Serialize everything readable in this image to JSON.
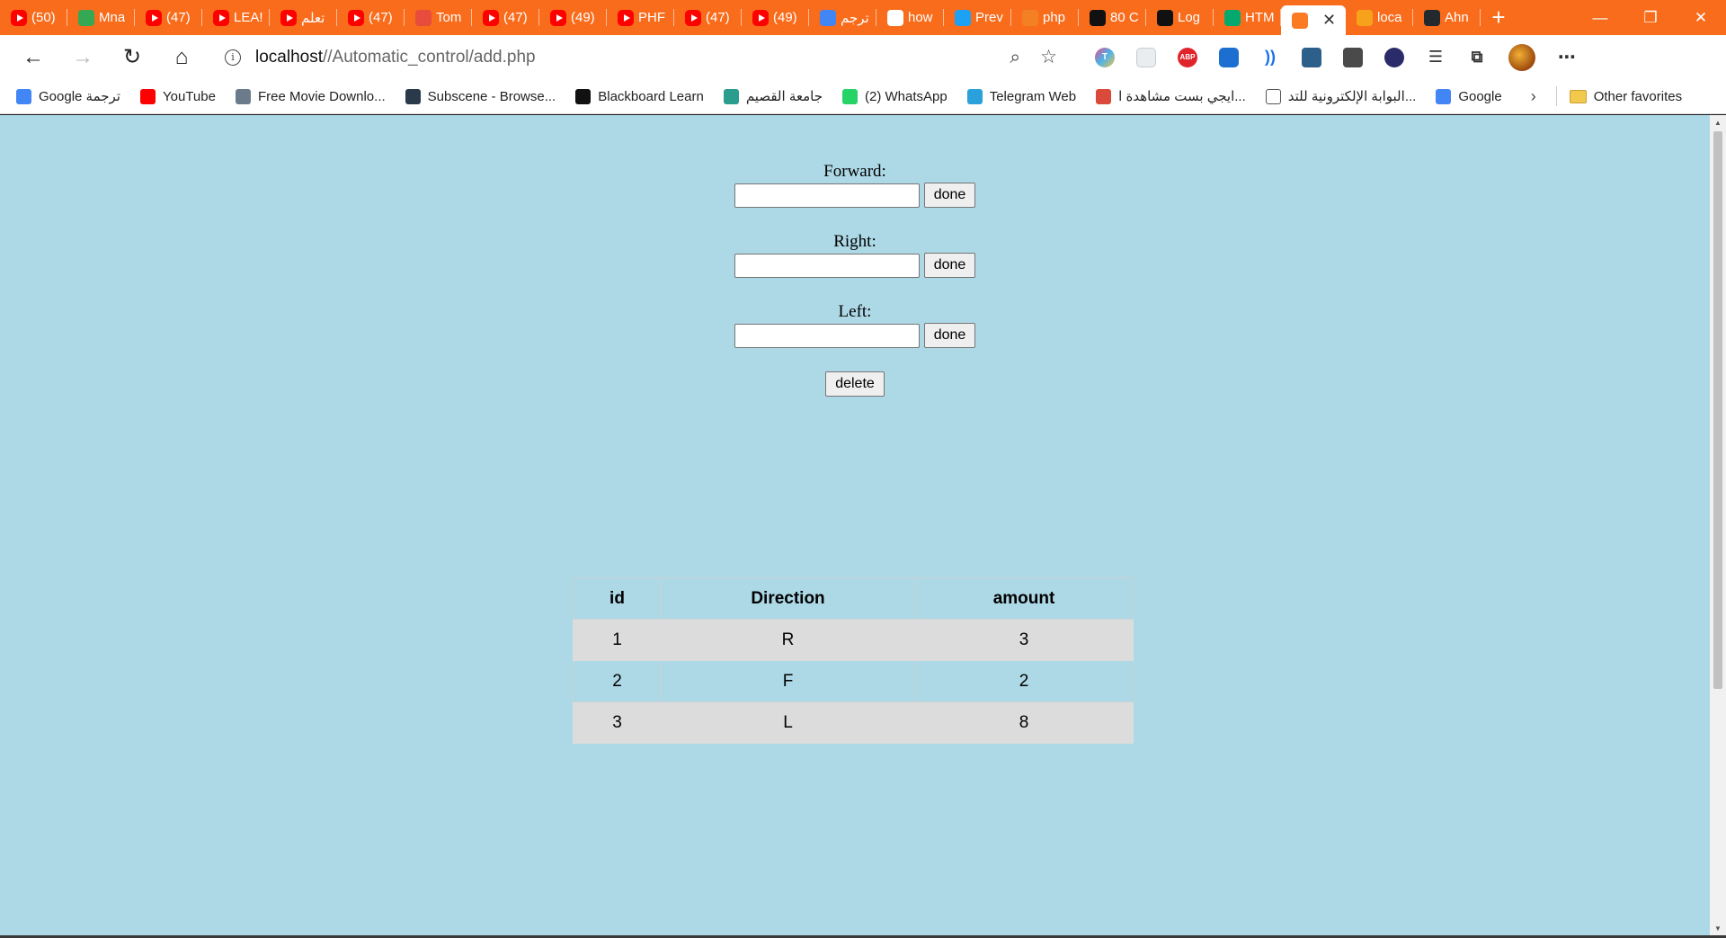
{
  "tabs": [
    {
      "icon": "youtube-icon",
      "label": "(50)"
    },
    {
      "icon": "play-store-icon",
      "label": "Mna"
    },
    {
      "icon": "youtube-icon",
      "label": "(47)"
    },
    {
      "icon": "youtube-icon",
      "label": "LEA!"
    },
    {
      "icon": "youtube-icon",
      "label": "تعلم"
    },
    {
      "icon": "youtube-icon",
      "label": "(47)"
    },
    {
      "icon": "tomato-icon",
      "label": "Tom"
    },
    {
      "icon": "youtube-icon",
      "label": "(47)"
    },
    {
      "icon": "youtube-icon",
      "label": "(49)"
    },
    {
      "icon": "youtube-icon",
      "label": "PHF"
    },
    {
      "icon": "youtube-icon",
      "label": "(47)"
    },
    {
      "icon": "youtube-icon",
      "label": "(49)"
    },
    {
      "icon": "google-translate-icon",
      "label": "ترجم"
    },
    {
      "icon": "google-icon",
      "label": "how"
    },
    {
      "icon": "m-icon",
      "label": "Prev"
    },
    {
      "icon": "stack-icon",
      "label": "php"
    },
    {
      "icon": "f-icon",
      "label": "80 C"
    },
    {
      "icon": "codepen-icon",
      "label": "Log"
    },
    {
      "icon": "w3-icon",
      "label": "HTM"
    },
    {
      "icon": "xampp-icon",
      "label": "",
      "active": true
    },
    {
      "icon": "xampp-pma-icon",
      "label": "loca"
    },
    {
      "icon": "github-icon",
      "label": "Ahn"
    }
  ],
  "window": {
    "minimize": "—",
    "restore": "❐",
    "close": "✕"
  },
  "toolbar": {
    "back": "←",
    "forward": "→",
    "reload": "↻",
    "home": "⌂",
    "url_host": "localhost",
    "url_path": "//Automatic_control/add.php",
    "zoom_icon": "⌕",
    "star_icon": "☆"
  },
  "favorites": [
    {
      "icon": "google-translate-icon",
      "label": "Google ترجمة",
      "color": "#4285f4"
    },
    {
      "icon": "youtube-icon",
      "label": "YouTube",
      "color": "#ff0000"
    },
    {
      "icon": "download-icon",
      "label": "Free Movie Downlo...",
      "color": "#6b7b8c"
    },
    {
      "icon": "subscene-icon",
      "label": "Subscene - Browse...",
      "color": "#2b3a4a"
    },
    {
      "icon": "blackboard-icon",
      "label": "Blackboard Learn",
      "color": "#111111"
    },
    {
      "icon": "qassim-icon",
      "label": "جامعة القصيم",
      "color": "#2a9d8f"
    },
    {
      "icon": "whatsapp-icon",
      "label": "(2) WhatsApp",
      "color": "#25d366"
    },
    {
      "icon": "telegram-icon",
      "label": "Telegram Web",
      "color": "#2aa1da"
    },
    {
      "icon": "egybest-icon",
      "label": "ايجي بست مشاهدة ا...",
      "color": "#d94a3a"
    },
    {
      "icon": "page-icon",
      "label": "البوابة الإلكترونية للتد...",
      "color": "#ffffff"
    },
    {
      "icon": "google-icon",
      "label": "Google",
      "color": "#4285f4"
    }
  ],
  "favorites_more": "›",
  "other_favorites": "Other favorites",
  "form": {
    "forward_label": "Forward:",
    "right_label": "Right:",
    "left_label": "Left:",
    "done_label": "done",
    "delete_label": "delete",
    "forward_value": "",
    "right_value": "",
    "left_value": ""
  },
  "table": {
    "headers": [
      "id",
      "Direction",
      "amount"
    ],
    "rows": [
      [
        "1",
        "R",
        "3"
      ],
      [
        "2",
        "F",
        "2"
      ],
      [
        "3",
        "L",
        "8"
      ]
    ]
  },
  "colors": {
    "tabstrip": "#f86c1c",
    "page_background": "#add8e6",
    "row_striped": "#dcdcdc"
  }
}
